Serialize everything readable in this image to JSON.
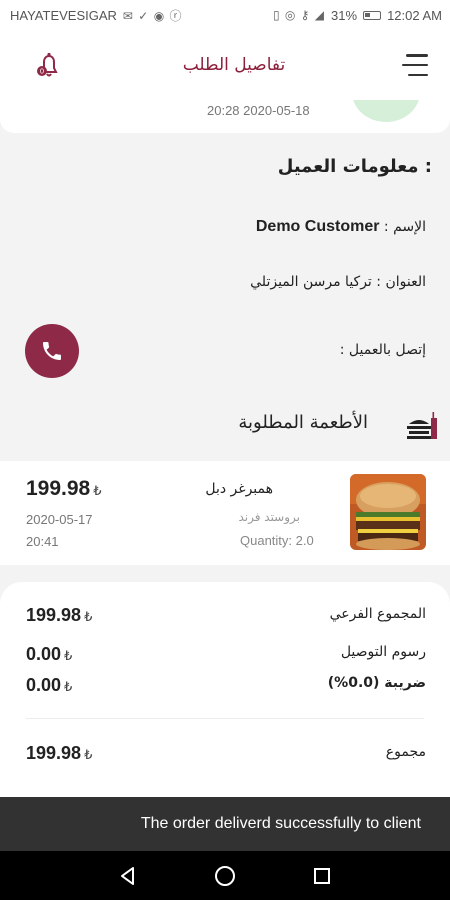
{
  "status_bar": {
    "carrier": "HAYATEVESIGAR",
    "battery": "31%",
    "time": "12:02 AM"
  },
  "header": {
    "title": "تفاصيل الطلب"
  },
  "top_card": {
    "datetime": "20:28 2020-05-18"
  },
  "customer": {
    "section_title": "معلومات العميل :",
    "name_label": "الإسم :",
    "name_value": "Demo Customer",
    "address_label": "العنوان :",
    "address_value": "تركيا مرسن الميزتلي",
    "call_label": "إتصل بالعميل :"
  },
  "foods": {
    "section_title": "الأطعمة المطلوبة",
    "items": [
      {
        "name": "همبرغر دبل",
        "category": "بروستد فرند",
        "quantity": "Quantity: 2.0",
        "price": "199.98",
        "currency": "₺",
        "date": "2020-05-17",
        "time": "20:41"
      }
    ]
  },
  "totals": {
    "subtotal_label": "المجموع الفرعي",
    "subtotal_value": "199.98",
    "delivery_label": "رسوم التوصيل",
    "delivery_value": "0.00",
    "tax_label": "ضريبة (0.0%)",
    "tax_value": "0.00",
    "total_label": "مجموع",
    "total_value": "199.98",
    "currency": "₺"
  },
  "snackbar": {
    "message": "The order deliverd successfully to client"
  },
  "colors": {
    "accent": "#8e2a47",
    "title": "#8e1f3b"
  }
}
